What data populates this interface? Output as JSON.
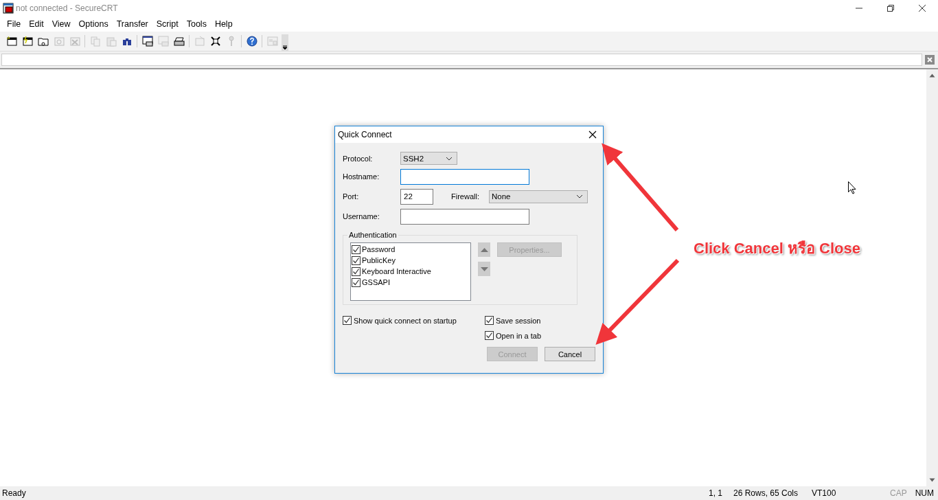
{
  "window": {
    "title": "not connected - SecureCRT"
  },
  "menu": [
    {
      "label": "File"
    },
    {
      "label": "Edit"
    },
    {
      "label": "View"
    },
    {
      "label": "Options"
    },
    {
      "label": "Transfer"
    },
    {
      "label": "Script"
    },
    {
      "label": "Tools"
    },
    {
      "label": "Help"
    }
  ],
  "toolbar": [
    {
      "kind": "button",
      "disabled": false
    },
    {
      "kind": "button",
      "disabled": false
    },
    {
      "kind": "button",
      "disabled": false
    },
    {
      "kind": "button",
      "disabled": true
    },
    {
      "kind": "button",
      "disabled": true
    },
    {
      "kind": "separator"
    },
    {
      "kind": "button",
      "disabled": true
    },
    {
      "kind": "button",
      "disabled": true
    },
    {
      "kind": "button",
      "disabled": false
    },
    {
      "kind": "separator"
    },
    {
      "kind": "button",
      "disabled": false
    },
    {
      "kind": "button",
      "disabled": true
    },
    {
      "kind": "button",
      "disabled": false
    },
    {
      "kind": "separator"
    },
    {
      "kind": "button",
      "disabled": true
    },
    {
      "kind": "button",
      "disabled": false
    },
    {
      "kind": "button",
      "disabled": true
    },
    {
      "kind": "separator"
    },
    {
      "kind": "button",
      "disabled": false
    },
    {
      "kind": "separator"
    },
    {
      "kind": "button",
      "disabled": true
    }
  ],
  "dialog": {
    "title": "Quick Connect",
    "protocol": {
      "label": "Protocol:",
      "value": "SSH2"
    },
    "hostname": {
      "label": "Hostname:",
      "focused": true
    },
    "port": {
      "label": "Port:",
      "value": "22"
    },
    "firewall": {
      "label": "Firewall:",
      "value": "None"
    },
    "username": {
      "label": "Username:"
    },
    "authentication": {
      "title": "Authentication",
      "methods": [
        {
          "label": "Password",
          "checked": true
        },
        {
          "label": "PublicKey",
          "checked": true
        },
        {
          "label": "Keyboard Interactive",
          "checked": true
        },
        {
          "label": "GSSAPI",
          "checked": true
        }
      ],
      "properties_button": {
        "label": "Properties...",
        "disabled": true
      }
    },
    "options": [
      {
        "label": "Show quick connect on startup",
        "checked": true
      },
      {
        "label": "Save session",
        "checked": true
      },
      {
        "label": "Open in a tab",
        "checked": true
      }
    ],
    "buttons": [
      {
        "label": "Connect",
        "disabled": true
      },
      {
        "label": "Cancel",
        "disabled": false
      }
    ]
  },
  "annotation": {
    "text": "Click Cancel หรือ Close"
  },
  "status_bar": {
    "message": "Ready",
    "cursor": "1,  1",
    "size": "26 Rows,  65 Cols",
    "emulation": "VT100",
    "indicators": [
      {
        "label": "CAP",
        "on": false
      },
      {
        "label": "NUM",
        "on": true
      }
    ]
  }
}
